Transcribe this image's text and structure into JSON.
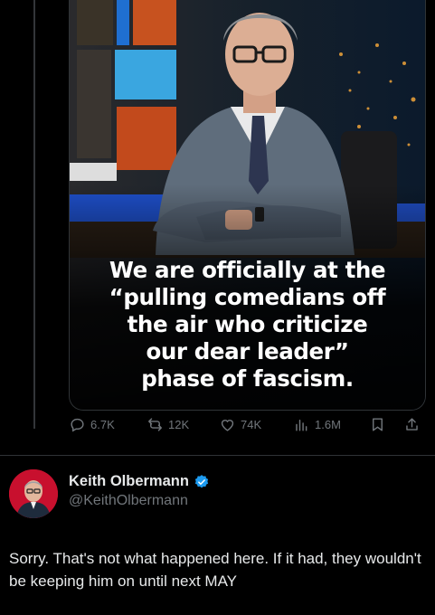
{
  "media": {
    "caption_lines": [
      "We are officially at the",
      "“pulling comedians off",
      "the air who criticize",
      "our dear leader”",
      "phase of fascism."
    ]
  },
  "actions": {
    "replies": "6.7K",
    "reposts": "12K",
    "likes": "74K",
    "views": "1.6M"
  },
  "reply": {
    "author_name": "Keith Olbermann",
    "handle": "@KeithOlbermann",
    "verified": true,
    "text": "Sorry. That's not what happened here. If it had, they wouldn't be keeping him on until next MAY"
  },
  "colors": {
    "background": "#000000",
    "muted": "#71767b",
    "verified": "#1d9bf0",
    "avatar_bg": "#c8102e"
  },
  "icons": [
    "reply-icon",
    "repost-icon",
    "like-icon",
    "views-icon",
    "bookmark-icon",
    "share-icon",
    "verified-badge-icon"
  ]
}
